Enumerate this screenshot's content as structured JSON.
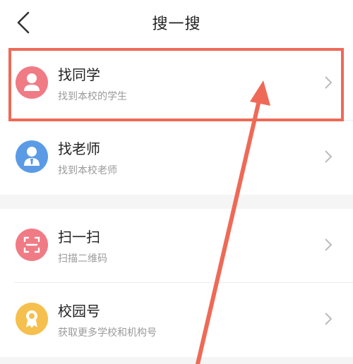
{
  "header": {
    "title": "搜一搜"
  },
  "groups": [
    {
      "items": [
        {
          "title": "找同学",
          "subtitle": "找到本校的学生",
          "icon": "student-icon",
          "color": "#f07b85"
        },
        {
          "title": "找老师",
          "subtitle": "找到本校老师",
          "icon": "teacher-icon",
          "color": "#5b9be6"
        }
      ]
    },
    {
      "items": [
        {
          "title": "扫一扫",
          "subtitle": "扫描二维码",
          "icon": "scan-icon",
          "color": "#f07b85"
        },
        {
          "title": "校园号",
          "subtitle": "获取更多学校和机构号",
          "icon": "campus-badge-icon",
          "color": "#f5c04d"
        }
      ]
    }
  ],
  "annotation": {
    "color": "#ee6a57"
  }
}
